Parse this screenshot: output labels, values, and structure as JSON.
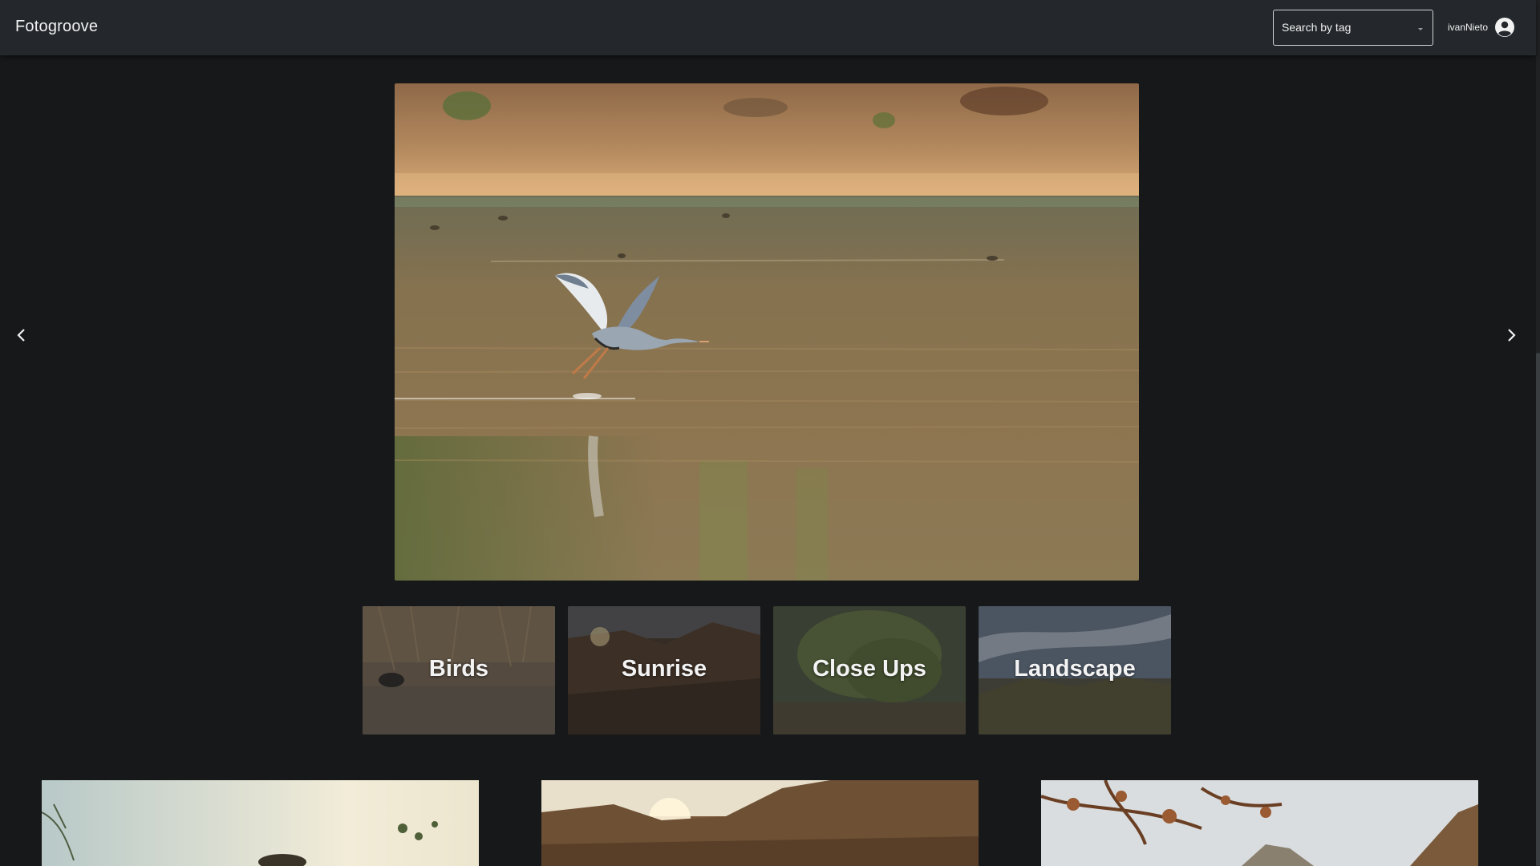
{
  "app": {
    "brand": "Fotogroove"
  },
  "header": {
    "tag_select": {
      "value": "Search by tag",
      "icon": "chevron-down-icon"
    },
    "user": {
      "name": "ivanNieto",
      "icon": "user-circle-icon"
    }
  },
  "carousel": {
    "prev_icon": "chevron-left-icon",
    "next_icon": "chevron-right-icon",
    "current_photo": "heron-over-water-photo"
  },
  "categories": [
    {
      "label": "Birds"
    },
    {
      "label": "Sunrise"
    },
    {
      "label": "Close Ups"
    },
    {
      "label": "Landscape"
    }
  ],
  "colors": {
    "background": "#161819",
    "topbar": "#24282c",
    "text": "#f1f1f1"
  }
}
